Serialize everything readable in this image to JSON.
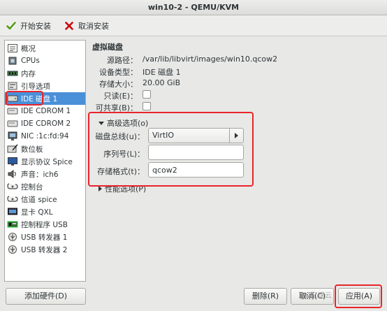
{
  "window": {
    "title": "win10-2 - QEMU/KVM"
  },
  "toolbar": {
    "begin_install": "开始安装",
    "cancel_install": "取消安装"
  },
  "sidebar": {
    "items": [
      {
        "label": "概况",
        "icon": "overview-icon"
      },
      {
        "label": "CPUs",
        "icon": "cpu-icon"
      },
      {
        "label": "内存",
        "icon": "memory-icon"
      },
      {
        "label": "引导选项",
        "icon": "boot-options-icon"
      },
      {
        "label": "IDE 磁盘 1",
        "icon": "disk-icon",
        "selected": true
      },
      {
        "label": "IDE CDROM 1",
        "icon": "cdrom-icon"
      },
      {
        "label": "IDE CDROM 2",
        "icon": "cdrom-icon"
      },
      {
        "label": "NIC :1c:fd:94",
        "icon": "network-icon"
      },
      {
        "label": "数位板",
        "icon": "tablet-icon"
      },
      {
        "label": "显示协议 Spice",
        "icon": "display-icon"
      },
      {
        "label": "声音：ich6",
        "icon": "sound-icon"
      },
      {
        "label": "控制台",
        "icon": "console-icon"
      },
      {
        "label": "信道 spice",
        "icon": "channel-icon"
      },
      {
        "label": "显卡 QXL",
        "icon": "video-card-icon"
      },
      {
        "label": "控制程序 USB",
        "icon": "controller-icon"
      },
      {
        "label": "USB 转发器 1",
        "icon": "usb-redirector-icon"
      },
      {
        "label": "USB 转发器 2",
        "icon": "usb-redirector-icon"
      }
    ]
  },
  "disk": {
    "section_title": "虚拟磁盘",
    "source_path_label": "源路径：",
    "source_path": "/var/lib/libvirt/images/win10.qcow2",
    "device_type_label": "设备类型：",
    "device_type": "IDE 磁盘 1",
    "storage_size_label": "存储大小：",
    "storage_size": "20.00 GiB",
    "readonly_label": "只读(E)：",
    "shareable_label": "可共享(B)："
  },
  "advanced": {
    "header": "高级选项(o)",
    "disk_bus_label": "磁盘总线(u)：",
    "disk_bus_value": "VirtIO",
    "serial_label": "序列号(L)：",
    "serial_value": "",
    "storage_format_label": "存储格式(t)：",
    "storage_format_value": "qcow2"
  },
  "performance": {
    "header": "性能选项(P)"
  },
  "buttons": {
    "add_hardware": "添加硬件(D)",
    "remove": "删除(R)",
    "cancel": "取消(C)",
    "apply": "应用(A)"
  },
  "watermark": "亿速云",
  "colors": {
    "selection": "#4a90d9",
    "highlight_box": "#e8252a",
    "accept_icon": "#4e9a06",
    "cancel_icon": "#cc0000"
  }
}
